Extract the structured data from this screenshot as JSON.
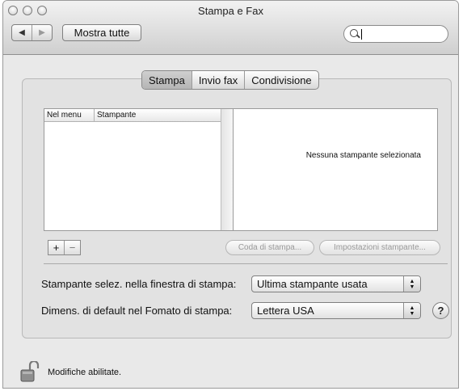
{
  "window": {
    "title": "Stampa e Fax"
  },
  "toolbar": {
    "back_icon": "back-arrow-icon",
    "forward_icon": "forward-arrow-icon",
    "back_glyph": "◀",
    "forward_glyph": "▶",
    "show_all_label": "Mostra tutte",
    "search_value": ""
  },
  "tabs": [
    {
      "label": "Stampa",
      "selected": true
    },
    {
      "label": "Invio fax",
      "selected": false
    },
    {
      "label": "Condivisione",
      "selected": false
    }
  ],
  "printer_list": {
    "columns": [
      "Nel menu",
      "Stampante"
    ],
    "rows": []
  },
  "detail": {
    "message": "Nessuna stampante selezionata"
  },
  "list_buttons": {
    "add_label": "+",
    "remove_label": "−"
  },
  "actions": {
    "queue_label": "Coda di stampa...",
    "settings_label": "Impostazioni stampante..."
  },
  "settings": {
    "printer_label": "Stampante selez. nella finestra di stampa:",
    "printer_value": "Ultima stampante usata",
    "paper_label": "Dimens. di default nel Fomato di stampa:",
    "paper_value": "Lettera USA"
  },
  "help": {
    "label": "?"
  },
  "footer": {
    "lock_icon": "lock-open-icon",
    "status": "Modifiche abilitate."
  }
}
